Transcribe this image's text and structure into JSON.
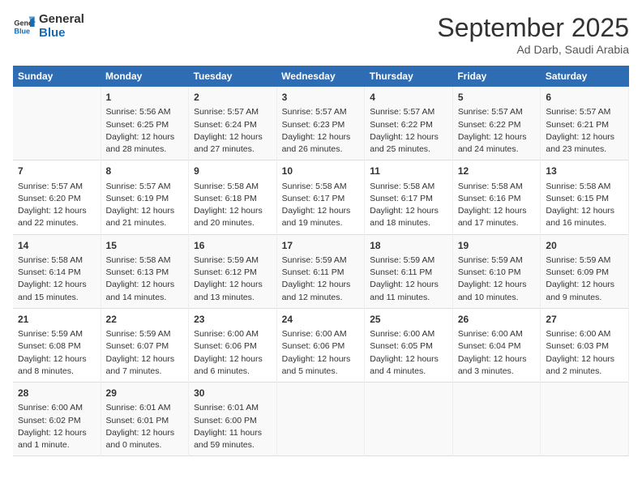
{
  "logo": {
    "line1": "General",
    "line2": "Blue"
  },
  "title": "September 2025",
  "subtitle": "Ad Darb, Saudi Arabia",
  "days_of_week": [
    "Sunday",
    "Monday",
    "Tuesday",
    "Wednesday",
    "Thursday",
    "Friday",
    "Saturday"
  ],
  "weeks": [
    [
      {
        "num": "",
        "info": ""
      },
      {
        "num": "1",
        "info": "Sunrise: 5:56 AM\nSunset: 6:25 PM\nDaylight: 12 hours\nand 28 minutes."
      },
      {
        "num": "2",
        "info": "Sunrise: 5:57 AM\nSunset: 6:24 PM\nDaylight: 12 hours\nand 27 minutes."
      },
      {
        "num": "3",
        "info": "Sunrise: 5:57 AM\nSunset: 6:23 PM\nDaylight: 12 hours\nand 26 minutes."
      },
      {
        "num": "4",
        "info": "Sunrise: 5:57 AM\nSunset: 6:22 PM\nDaylight: 12 hours\nand 25 minutes."
      },
      {
        "num": "5",
        "info": "Sunrise: 5:57 AM\nSunset: 6:22 PM\nDaylight: 12 hours\nand 24 minutes."
      },
      {
        "num": "6",
        "info": "Sunrise: 5:57 AM\nSunset: 6:21 PM\nDaylight: 12 hours\nand 23 minutes."
      }
    ],
    [
      {
        "num": "7",
        "info": "Sunrise: 5:57 AM\nSunset: 6:20 PM\nDaylight: 12 hours\nand 22 minutes."
      },
      {
        "num": "8",
        "info": "Sunrise: 5:57 AM\nSunset: 6:19 PM\nDaylight: 12 hours\nand 21 minutes."
      },
      {
        "num": "9",
        "info": "Sunrise: 5:58 AM\nSunset: 6:18 PM\nDaylight: 12 hours\nand 20 minutes."
      },
      {
        "num": "10",
        "info": "Sunrise: 5:58 AM\nSunset: 6:17 PM\nDaylight: 12 hours\nand 19 minutes."
      },
      {
        "num": "11",
        "info": "Sunrise: 5:58 AM\nSunset: 6:17 PM\nDaylight: 12 hours\nand 18 minutes."
      },
      {
        "num": "12",
        "info": "Sunrise: 5:58 AM\nSunset: 6:16 PM\nDaylight: 12 hours\nand 17 minutes."
      },
      {
        "num": "13",
        "info": "Sunrise: 5:58 AM\nSunset: 6:15 PM\nDaylight: 12 hours\nand 16 minutes."
      }
    ],
    [
      {
        "num": "14",
        "info": "Sunrise: 5:58 AM\nSunset: 6:14 PM\nDaylight: 12 hours\nand 15 minutes."
      },
      {
        "num": "15",
        "info": "Sunrise: 5:58 AM\nSunset: 6:13 PM\nDaylight: 12 hours\nand 14 minutes."
      },
      {
        "num": "16",
        "info": "Sunrise: 5:59 AM\nSunset: 6:12 PM\nDaylight: 12 hours\nand 13 minutes."
      },
      {
        "num": "17",
        "info": "Sunrise: 5:59 AM\nSunset: 6:11 PM\nDaylight: 12 hours\nand 12 minutes."
      },
      {
        "num": "18",
        "info": "Sunrise: 5:59 AM\nSunset: 6:11 PM\nDaylight: 12 hours\nand 11 minutes."
      },
      {
        "num": "19",
        "info": "Sunrise: 5:59 AM\nSunset: 6:10 PM\nDaylight: 12 hours\nand 10 minutes."
      },
      {
        "num": "20",
        "info": "Sunrise: 5:59 AM\nSunset: 6:09 PM\nDaylight: 12 hours\nand 9 minutes."
      }
    ],
    [
      {
        "num": "21",
        "info": "Sunrise: 5:59 AM\nSunset: 6:08 PM\nDaylight: 12 hours\nand 8 minutes."
      },
      {
        "num": "22",
        "info": "Sunrise: 5:59 AM\nSunset: 6:07 PM\nDaylight: 12 hours\nand 7 minutes."
      },
      {
        "num": "23",
        "info": "Sunrise: 6:00 AM\nSunset: 6:06 PM\nDaylight: 12 hours\nand 6 minutes."
      },
      {
        "num": "24",
        "info": "Sunrise: 6:00 AM\nSunset: 6:06 PM\nDaylight: 12 hours\nand 5 minutes."
      },
      {
        "num": "25",
        "info": "Sunrise: 6:00 AM\nSunset: 6:05 PM\nDaylight: 12 hours\nand 4 minutes."
      },
      {
        "num": "26",
        "info": "Sunrise: 6:00 AM\nSunset: 6:04 PM\nDaylight: 12 hours\nand 3 minutes."
      },
      {
        "num": "27",
        "info": "Sunrise: 6:00 AM\nSunset: 6:03 PM\nDaylight: 12 hours\nand 2 minutes."
      }
    ],
    [
      {
        "num": "28",
        "info": "Sunrise: 6:00 AM\nSunset: 6:02 PM\nDaylight: 12 hours\nand 1 minute."
      },
      {
        "num": "29",
        "info": "Sunrise: 6:01 AM\nSunset: 6:01 PM\nDaylight: 12 hours\nand 0 minutes."
      },
      {
        "num": "30",
        "info": "Sunrise: 6:01 AM\nSunset: 6:00 PM\nDaylight: 11 hours\nand 59 minutes."
      },
      {
        "num": "",
        "info": ""
      },
      {
        "num": "",
        "info": ""
      },
      {
        "num": "",
        "info": ""
      },
      {
        "num": "",
        "info": ""
      }
    ]
  ]
}
